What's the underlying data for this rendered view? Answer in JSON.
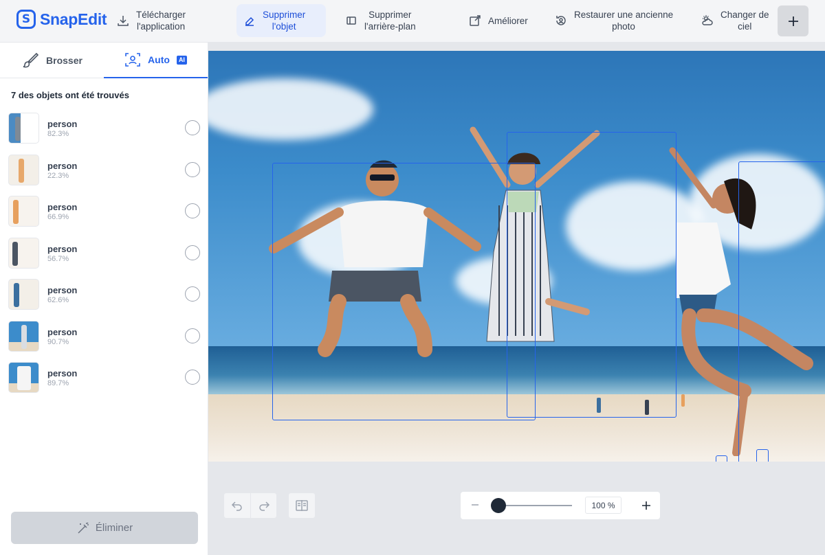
{
  "app": {
    "name": "SnapEdit"
  },
  "nav": {
    "items": [
      {
        "label": "Télécharger\nl'application",
        "icon": "download-icon"
      },
      {
        "label": "Supprimer\nl'objet",
        "icon": "eraser-icon",
        "active": true
      },
      {
        "label": "Supprimer\nl'arrière-plan",
        "icon": "background-remove-icon"
      },
      {
        "label": "Améliorer",
        "icon": "enhance-icon"
      },
      {
        "label": "Restaurer une ancienne\nphoto",
        "icon": "restore-photo-icon"
      },
      {
        "label": "Changer de\nciel",
        "icon": "sky-icon"
      }
    ],
    "plus_icon": "plus-icon"
  },
  "sidebar": {
    "tabs": [
      {
        "label": "Brosser",
        "icon": "brush-icon"
      },
      {
        "label": "Auto",
        "icon": "auto-detect-icon",
        "badge": "AI",
        "active": true
      }
    ],
    "found_text": "7 des objets ont été trouvés",
    "objects": [
      {
        "name": "person",
        "score": "82.3%"
      },
      {
        "name": "person",
        "score": "22.3%"
      },
      {
        "name": "person",
        "score": "66.9%"
      },
      {
        "name": "person",
        "score": "56.7%"
      },
      {
        "name": "person",
        "score": "62.6%"
      },
      {
        "name": "person",
        "score": "90.7%"
      },
      {
        "name": "person",
        "score": "89.7%"
      }
    ],
    "eliminate_label": "Éliminer"
  },
  "canvas": {
    "zoom_value": "100 %",
    "controls": [
      "undo-icon",
      "redo-icon",
      "compare-icon",
      "zoom-out-icon",
      "zoom-in-icon"
    ]
  },
  "colors": {
    "accent": "#2563eb",
    "active_bg": "#e8eefc",
    "disabled_btn": "#d1d5db"
  }
}
